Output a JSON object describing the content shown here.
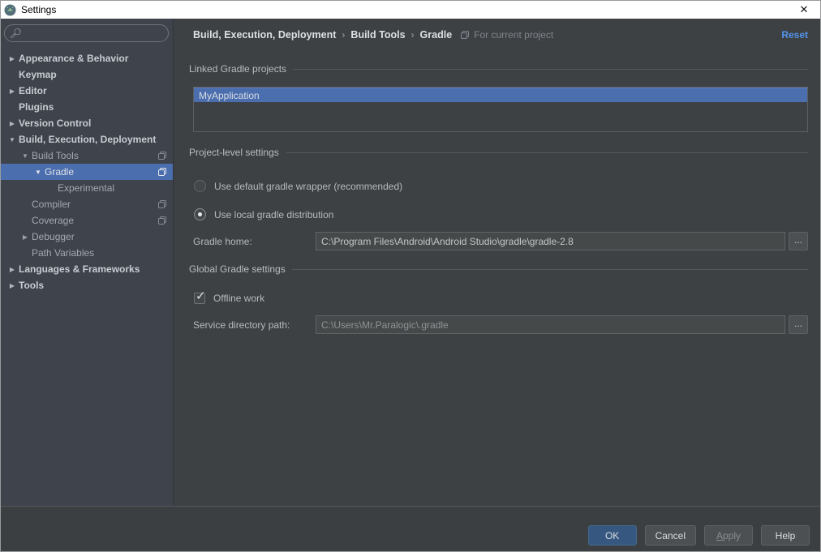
{
  "window": {
    "title": "Settings",
    "close_glyph": "✕"
  },
  "sidebar": {
    "search": {
      "placeholder": "",
      "value": "",
      "icon": "magnifier"
    },
    "items": [
      {
        "label": "Appearance & Behavior",
        "arrow": "▶"
      },
      {
        "label": "Keymap",
        "arrow": ""
      },
      {
        "label": "Editor",
        "arrow": "▶"
      },
      {
        "label": "Plugins",
        "arrow": ""
      },
      {
        "label": "Version Control",
        "arrow": "▶"
      },
      {
        "label": "Build, Execution, Deployment",
        "arrow": "▼"
      },
      {
        "label": "Build Tools",
        "arrow": "▼"
      },
      {
        "label": "Gradle",
        "arrow": "▼"
      },
      {
        "label": "Experimental",
        "arrow": ""
      },
      {
        "label": "Compiler",
        "arrow": ""
      },
      {
        "label": "Coverage",
        "arrow": ""
      },
      {
        "label": "Debugger",
        "arrow": "▶"
      },
      {
        "label": "Path Variables",
        "arrow": ""
      },
      {
        "label": "Languages & Frameworks",
        "arrow": "▶"
      },
      {
        "label": "Tools",
        "arrow": "▶"
      }
    ]
  },
  "breadcrumb": {
    "parts": {
      "0": "Build, Execution, Deployment",
      "1": "Build Tools",
      "2": "Gradle"
    },
    "separator": "›",
    "scope_note": "For current project",
    "reset_label": "Reset"
  },
  "linked_projects": {
    "title": "Linked Gradle projects",
    "rows": {
      "0": {
        "name": "MyApplication",
        "selected": true
      }
    }
  },
  "project_settings": {
    "title": "Project-level settings",
    "radio_default_wrapper": {
      "label": "Use default gradle wrapper (recommended)",
      "selected": false
    },
    "radio_local_distribution": {
      "label": "Use local gradle distribution",
      "selected": true
    },
    "gradle_home": {
      "label": "Gradle home:",
      "value": "C:\\Program Files\\Android\\Android Studio\\gradle\\gradle-2.8",
      "browse_label": "..."
    }
  },
  "global_settings": {
    "title": "Global Gradle settings",
    "offline_work": {
      "label": "Offline work",
      "checked": true
    },
    "service_directory": {
      "label": "Service directory path:",
      "value": "C:\\Users\\Mr.Paralogic\\.gradle",
      "browse_label": "..."
    }
  },
  "footer": {
    "ok": "OK",
    "cancel": "Cancel",
    "apply": "Apply",
    "help": "Help"
  },
  "colors": {
    "selection_blue": "#4B6EAF",
    "accent_link": "#5394EC",
    "primary_button": "#365880",
    "sidebar_bg": "#3E434C",
    "content_bg": "#3E4144",
    "titlebar_bg": "#FFFFFF"
  }
}
